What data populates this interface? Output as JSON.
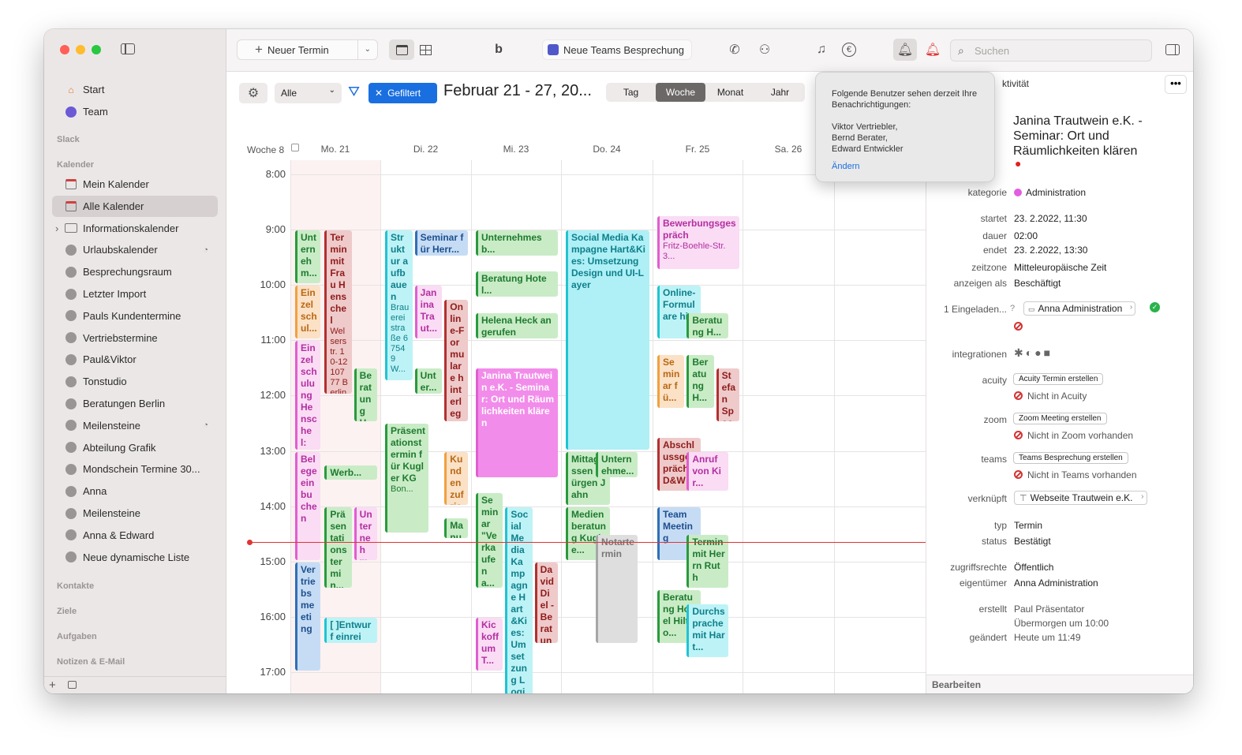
{
  "sidebar": {
    "top_items": [
      {
        "label": "Start",
        "icon": "home-icon"
      },
      {
        "label": "Team",
        "icon": "team-icon"
      }
    ],
    "sections": {
      "slack": "Slack",
      "kalender": "Kalender",
      "kontakte": "Kontakte",
      "ziele": "Ziele",
      "aufgaben": "Aufgaben",
      "notizen": "Notizen & E-Mail"
    },
    "calendars": [
      {
        "label": "Mein Kalender",
        "icon": "calendar-icon"
      },
      {
        "label": "Alle Kalender",
        "icon": "calendar-icon",
        "selected": true
      },
      {
        "label": "Informationskalender",
        "icon": "folder-icon"
      },
      {
        "label": "Urlaubskalender",
        "icon": "shared-calendar-icon",
        "shared": true
      },
      {
        "label": "Besprechungsraum",
        "icon": "shared-calendar-icon"
      },
      {
        "label": "Letzter Import",
        "icon": "shared-calendar-icon"
      },
      {
        "label": "Pauls Kundentermine",
        "icon": "shared-calendar-icon"
      },
      {
        "label": "Vertriebstermine",
        "icon": "shared-calendar-icon"
      },
      {
        "label": "Paul&Viktor",
        "icon": "shared-calendar-icon"
      },
      {
        "label": "Tonstudio",
        "icon": "shared-calendar-icon"
      },
      {
        "label": "Beratungen Berlin",
        "icon": "shared-calendar-icon"
      },
      {
        "label": "Meilensteine",
        "icon": "shared-calendar-icon",
        "shared": true
      },
      {
        "label": "Abteilung Grafik",
        "icon": "shared-calendar-icon"
      },
      {
        "label": "Mondschein Termine 30...",
        "icon": "shared-calendar-icon"
      },
      {
        "label": "Anna",
        "icon": "shared-calendar-icon"
      },
      {
        "label": "Meilensteine",
        "icon": "shared-calendar-icon"
      },
      {
        "label": "Anna & Edward",
        "icon": "shared-calendar-icon"
      },
      {
        "label": "Neue dynamische Liste",
        "icon": "shared-calendar-icon"
      }
    ]
  },
  "toolbar": {
    "new_event": "Neuer Termin",
    "teams_meeting": "Neue Teams Besprechung",
    "search_placeholder": "Suchen"
  },
  "filterbar": {
    "filter_select": "Alle",
    "filtered_label": "Gefiltert",
    "date_range": "Februar 21 - 27, 20...",
    "views": [
      "Tag",
      "Woche",
      "Monat",
      "Jahr"
    ],
    "active_view": "Woche"
  },
  "week": {
    "week_label": "Woche 8",
    "days": [
      "Mo. 21",
      "Di. 22",
      "Mi. 23",
      "Do. 24",
      "Fr. 25",
      "Sa. 26"
    ],
    "hours": [
      "8:00",
      "9:00",
      "10:00",
      "11:00",
      "12:00",
      "13:00",
      "14:00",
      "15:00",
      "16:00",
      "17:00"
    ]
  },
  "events": [
    {
      "title": "Unternehm...",
      "sub": "",
      "color": "green",
      "day": 0,
      "start": 9.0,
      "end": 10.0,
      "col": 0,
      "w": 0.28
    },
    {
      "title": "Einzelschul...",
      "sub": "",
      "color": "orange",
      "day": 0,
      "start": 10.0,
      "end": 11.0,
      "col": 0,
      "w": 0.28
    },
    {
      "title": "Einzelschulung Henschel: M...",
      "sub": "",
      "color": "pink",
      "day": 0,
      "start": 11.0,
      "end": 13.0,
      "col": 0,
      "w": 0.28
    },
    {
      "title": "Belegeeinbuchen",
      "sub": "",
      "color": "pink",
      "day": 0,
      "start": 13.0,
      "end": 15.0,
      "col": 0,
      "w": 0.28
    },
    {
      "title": "Vertriebsmeeting",
      "sub": "",
      "color": "blue",
      "day": 0,
      "start": 15.0,
      "end": 17.0,
      "col": 0,
      "w": 0.28
    },
    {
      "title": "Termin mit Frau Henschel",
      "sub": "Welserstr. 10-12 10777 Berlin Deutsts...",
      "color": "red",
      "day": 0,
      "start": 9.0,
      "end": 12.0,
      "col": 1,
      "w": 0.3
    },
    {
      "title": "Beratung H...",
      "sub": "",
      "color": "green",
      "day": 0,
      "start": 11.5,
      "end": 12.5,
      "col": 2,
      "w": 0.3
    },
    {
      "title": "Werb...",
      "sub": "",
      "color": "green",
      "day": 0,
      "start": 13.25,
      "end": 13.5,
      "col": 1,
      "w": 0.62
    },
    {
      "title": "Präsentationstermin...",
      "sub": "Pa...",
      "color": "green",
      "day": 0,
      "start": 14.0,
      "end": 15.5,
      "col": 1,
      "w": 0.3
    },
    {
      "title": "Unternehm...",
      "sub": "",
      "color": "pink",
      "day": 0,
      "start": 14.0,
      "end": 15.0,
      "col": 2,
      "w": 0.3
    },
    {
      "title": "[ ]Entwurf einreic...",
      "sub": "",
      "color": "cyan",
      "day": 0,
      "start": 16.0,
      "end": 16.5,
      "col": 1,
      "w": 0.62
    },
    {
      "title": "Struktur aufbauen",
      "sub": "Brauereistraße 67549 W...",
      "color": "cyan",
      "day": 1,
      "start": 9.0,
      "end": 11.75,
      "col": 0,
      "w": 0.3
    },
    {
      "title": "Seminar für Herr...",
      "sub": "",
      "color": "blue",
      "day": 1,
      "start": 9.0,
      "end": 9.5,
      "col": 1,
      "w": 0.62
    },
    {
      "title": "Janina Traut...",
      "sub": "",
      "color": "pink",
      "day": 1,
      "start": 10.0,
      "end": 11.0,
      "col": 1,
      "w": 0.3
    },
    {
      "title": "Online-Formulare hinterlegen",
      "sub": "Braue...",
      "color": "red",
      "day": 1,
      "start": 10.25,
      "end": 12.5,
      "col": 2,
      "w": 0.3
    },
    {
      "title": "Unter...",
      "sub": "",
      "color": "green",
      "day": 1,
      "start": 11.5,
      "end": 12.0,
      "col": 1,
      "w": 0.3
    },
    {
      "title": "Präsentationstermin für Kugler KG",
      "sub": "Bon...",
      "color": "green",
      "day": 1,
      "start": 12.5,
      "end": 14.5,
      "col": 0,
      "w": 0.48
    },
    {
      "title": "Kundenzufriedenheit aus...",
      "sub": "",
      "color": "orange",
      "day": 1,
      "start": 13.0,
      "end": 14.0,
      "col": 2,
      "w": 0.46
    },
    {
      "title": "Manuel Stev...",
      "sub": "",
      "color": "green",
      "day": 1,
      "start": 14.2,
      "end": 14.6,
      "col": 2,
      "w": 0.46
    },
    {
      "title": "Unternehmesb...",
      "sub": "",
      "color": "green",
      "day": 2,
      "start": 9.0,
      "end": 9.5,
      "col": 0,
      "w": 0.96
    },
    {
      "title": "Beratung Hotel...",
      "sub": "",
      "color": "green",
      "day": 2,
      "start": 9.75,
      "end": 10.25,
      "col": 0,
      "w": 0.96
    },
    {
      "title": "Helena Heck angerufen",
      "sub": "",
      "color": "green",
      "day": 2,
      "start": 10.5,
      "end": 11.0,
      "col": 0,
      "w": 0.96
    },
    {
      "title": "Janina Trautwein e.K. - Seminar: Ort und Räumlichkeiten klären",
      "sub": "",
      "color": "magenta-solid",
      "day": 2,
      "start": 11.5,
      "end": 13.5,
      "col": 0,
      "w": 0.96
    },
    {
      "title": "Seminar \"Verkaufen a...",
      "sub": "",
      "color": "green",
      "day": 2,
      "start": 13.75,
      "end": 15.5,
      "col": 0,
      "w": 0.3
    },
    {
      "title": "Social Media Kampagne Hart&Kies: Umsetzung Logik u...",
      "sub": "",
      "color": "cyan",
      "day": 2,
      "start": 14.0,
      "end": 17.9,
      "col": 1,
      "w": 0.3
    },
    {
      "title": "David Diel - Beratung: Berat...",
      "sub": "",
      "color": "red",
      "day": 2,
      "start": 15.0,
      "end": 16.5,
      "col": 2,
      "w": 0.3
    },
    {
      "title": "Kickoff um T...",
      "sub": "",
      "color": "pink",
      "day": 2,
      "start": 16.0,
      "end": 17.0,
      "col": 0,
      "w": 0.3
    },
    {
      "title": "Social Media Kampagne Hart&Kies: Umsetzung Design und UI-Layer",
      "sub": "",
      "color": "cyan-solid",
      "day": 3,
      "start": 9.0,
      "end": 13.0,
      "col": 0,
      "w": 0.96
    },
    {
      "title": "Mittagessen Jürgen Jahn",
      "sub": "",
      "color": "green",
      "day": 3,
      "start": 13.0,
      "end": 14.0,
      "col": 0,
      "w": 0.48
    },
    {
      "title": "Unternehme...",
      "sub": "",
      "color": "green",
      "day": 3,
      "start": 13.0,
      "end": 13.5,
      "col": 1,
      "w": 0.46
    },
    {
      "title": "Medienberatung Kugle...",
      "sub": "",
      "color": "green",
      "day": 3,
      "start": 14.0,
      "end": 15.0,
      "col": 0,
      "w": 0.48
    },
    {
      "title": "Notartermin",
      "sub": "",
      "color": "gray",
      "day": 3,
      "start": 14.5,
      "end": 16.5,
      "col": 1,
      "w": 0.46
    },
    {
      "title": "Bewerbungsgespräch",
      "sub": "Fritz-Boehle-Str. 3...",
      "color": "pink",
      "day": 4,
      "start": 8.75,
      "end": 9.75,
      "col": 0,
      "w": 0.96
    },
    {
      "title": "Online-Formulare hi...",
      "sub": "",
      "color": "cyan",
      "day": 4,
      "start": 10.0,
      "end": 11.0,
      "col": 0,
      "w": 0.48
    },
    {
      "title": "Beratung H...",
      "sub": "",
      "color": "green",
      "day": 4,
      "start": 10.5,
      "end": 11.0,
      "col": 1,
      "w": 0.46
    },
    {
      "title": "Seminar fü...",
      "sub": "",
      "color": "orange",
      "day": 4,
      "start": 11.25,
      "end": 12.25,
      "col": 0,
      "w": 0.3
    },
    {
      "title": "Beratung H...",
      "sub": "",
      "color": "green",
      "day": 4,
      "start": 11.25,
      "end": 12.25,
      "col": 1,
      "w": 0.3
    },
    {
      "title": "Stefan Spock...",
      "sub": "",
      "color": "red",
      "day": 4,
      "start": 11.5,
      "end": 12.5,
      "col": 2,
      "w": 0.3
    },
    {
      "title": "Abschlussgespräch D&W",
      "sub": "",
      "color": "red",
      "day": 4,
      "start": 12.75,
      "end": 13.75,
      "col": 0,
      "w": 0.48
    },
    {
      "title": "Anruf von Kir...",
      "sub": "",
      "color": "pink",
      "day": 4,
      "start": 13.0,
      "end": 13.75,
      "col": 1,
      "w": 0.46
    },
    {
      "title": "Team Meeting",
      "sub": "",
      "color": "blue",
      "day": 4,
      "start": 14.0,
      "end": 15.0,
      "col": 0,
      "w": 0.48
    },
    {
      "title": "Termin mit Herrn Ruth",
      "sub": "",
      "color": "green",
      "day": 4,
      "start": 14.5,
      "end": 15.5,
      "col": 1,
      "w": 0.46
    },
    {
      "title": "Beratung Hotel Hilto...",
      "sub": "",
      "color": "green",
      "day": 4,
      "start": 15.5,
      "end": 16.5,
      "col": 0,
      "w": 0.48
    },
    {
      "title": "Durchsprache mit Hart...",
      "sub": "",
      "color": "cyan",
      "day": 4,
      "start": 15.75,
      "end": 16.75,
      "col": 1,
      "w": 0.46
    }
  ],
  "current_time": 14.65,
  "popover": {
    "text": "Folgende Benutzer sehen derzeit Ihre Benachrichtigungen:",
    "users": [
      "Viktor Vertriebler,",
      "Bernd Berater,",
      "Edward Entwickler"
    ],
    "link": "Ändern"
  },
  "detail": {
    "tab_partial": "ktivität",
    "title": "Janina Trautwein e.K. - Seminar: Ort und Räumlichkeiten klären",
    "fields": {
      "kategorie_label": "kategorie",
      "kategorie_value": "Administration",
      "startet_label": "startet",
      "startet_value": "23.  2.2022,  11:30",
      "dauer_label": "dauer",
      "dauer_value": "02:00",
      "endet_label": "endet",
      "endet_value": "23.  2.2022,  13:30",
      "zeitzone_label": "zeitzone",
      "zeitzone_value": "Mitteleuropäische Zeit",
      "anzeigen_label": "anzeigen als",
      "anzeigen_value": "Beschäftigt",
      "eingeladen_label": "1 Eingeladen...",
      "eingeladen_value": "Anna Administration",
      "integrationen_label": "integrationen",
      "acuity_label": "acuity",
      "acuity_button": "Acuity Termin erstellen",
      "acuity_status": "Nicht in Acuity",
      "zoom_label": "zoom",
      "zoom_button": "Zoom Meeting erstellen",
      "zoom_status": "Nicht in Zoom vorhanden",
      "teams_label": "teams",
      "teams_button": "Teams Besprechung erstellen",
      "teams_status": "Nicht in Teams vorhanden",
      "verknuepft_label": "verknüpft",
      "verknuepft_value": "Webseite Trautwein e.K.",
      "typ_label": "typ",
      "typ_value": "Termin",
      "status_label": "status",
      "status_value": "Bestätigt",
      "zugriff_label": "zugriffsrechte",
      "zugriff_value": "Öffentlich",
      "eigentuemer_label": "eigentümer",
      "eigentuemer_value": "Anna Administration",
      "erstellt_label": "erstellt",
      "erstellt_value": "Paul Präsentator",
      "erstellt_time": "Übermorgen um 10:00",
      "geaendert_label": "geändert",
      "geaendert_value": "Heute um 11:49"
    },
    "footer": "Bearbeiten"
  },
  "colors": {
    "accent": "#1a6fe0",
    "category_admin": "#e25ee0",
    "now_line": "#e03535"
  }
}
